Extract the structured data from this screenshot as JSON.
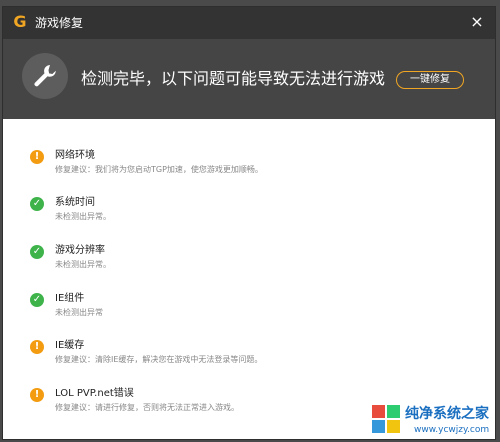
{
  "window": {
    "title": "游戏修复",
    "close_glyph": "×",
    "logo_glyph": "G"
  },
  "banner": {
    "message": "检测完毕，以下问题可能导致无法进行游戏",
    "repair_button": "一键修复",
    "icon": "wrench-icon"
  },
  "colors": {
    "accent": "#f1a623",
    "warning": "#f39c12",
    "ok": "#3db34a",
    "titlebar": "#333333",
    "banner": "#454545"
  },
  "issues": [
    {
      "status": "warning",
      "icon_glyph": "!",
      "name": "网络环境",
      "detail": "修复建议：我们将为您启动TGP加速，使您游戏更加顺畅。"
    },
    {
      "status": "ok",
      "icon_glyph": "✓",
      "name": "系统时间",
      "detail": "未检测出异常。"
    },
    {
      "status": "ok",
      "icon_glyph": "✓",
      "name": "游戏分辨率",
      "detail": "未检测出异常。"
    },
    {
      "status": "ok",
      "icon_glyph": "✓",
      "name": "IE组件",
      "detail": "未检测出异常"
    },
    {
      "status": "warning",
      "icon_glyph": "!",
      "name": "IE缓存",
      "detail": "修复建议：清除IE缓存，解决您在游戏中无法登录等问题。"
    },
    {
      "status": "warning",
      "icon_glyph": "!",
      "name": "LOL PVP.net错误",
      "detail": "修复建议：请进行修复，否则将无法正常进入游戏。"
    }
  ],
  "watermark": {
    "title": "纯净系统之家",
    "url": "www.ycwjzy.com"
  }
}
